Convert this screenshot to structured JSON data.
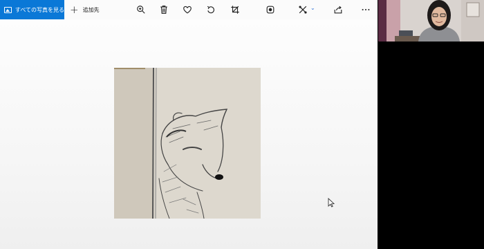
{
  "toolbar": {
    "all_photos_label": "すべての写真を見る",
    "add_to_label": "追加先",
    "icons": [
      "zoom-in-icon",
      "delete-icon",
      "favorite-icon",
      "rotate-icon",
      "crop-icon",
      "enhance-icon",
      "edit-create-icon",
      "share-icon",
      "more-icon"
    ],
    "accent_color": "#0a78d7"
  },
  "photo": {
    "subject": "pencil sketch of a dog"
  },
  "webcam": {
    "subject": "video call participant"
  }
}
